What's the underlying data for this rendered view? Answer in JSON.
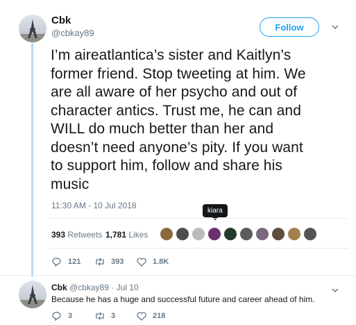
{
  "tweet": {
    "author_name": "Cbk",
    "author_handle": "@cbkay89",
    "follow_label": "Follow",
    "text": "I’m aireatlantica’s sister and Kaitlyn’s\nformer friend. Stop tweeting at him. We\nare all aware of her psycho and out of\ncharacter antics. Trust me, he can and\nWILL do much better than her and\ndoesn’t need anyone’s pity. If you want\nto support him, follow and share his\nmusic",
    "timestamp": "11:30 AM - 10 Jul 2018",
    "tooltip": "kiara",
    "retweets_count": "393",
    "retweets_label": "Retweets",
    "likes_count": "1,781",
    "likes_label": "Likes",
    "actions": {
      "replies": "121",
      "retweets": "393",
      "likes": "1.8K"
    }
  },
  "liker_colors": [
    "#8c6a3f",
    "#4d4d4d",
    "#bbbbbb",
    "#6b2f6f",
    "#233c2a",
    "#5b5b5b",
    "#7a6a7d",
    "#5f4d3f",
    "#a3804f",
    "#545454"
  ],
  "reply": {
    "author_name": "Cbk",
    "author_handle": "@cbkay89",
    "date": "· Jul 10",
    "text": "Because he has a huge and successful future and career ahead of him.",
    "actions": {
      "replies": "3",
      "retweets": "3",
      "likes": "218"
    }
  }
}
